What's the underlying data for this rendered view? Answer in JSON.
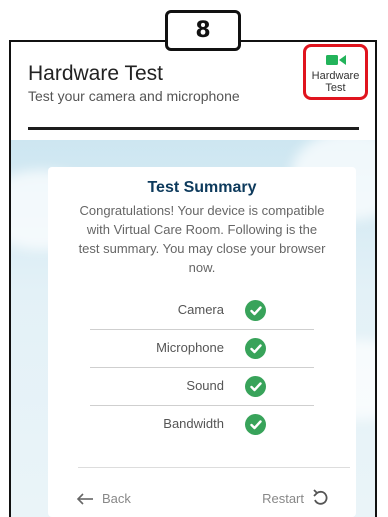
{
  "step_badge": "8",
  "header": {
    "title": "Hardware Test",
    "subtitle": "Test your camera and microphone",
    "hardware_test_button": {
      "line1": "Hardware",
      "line2": "Test",
      "icon": "video-camera-icon"
    }
  },
  "summary": {
    "title": "Test Summary",
    "body_lines": [
      "Congratulations! Your device is compatible",
      "with Virtual Care Room. Following is the",
      "test summary. You may close your browser",
      "now."
    ],
    "results": [
      {
        "label": "Camera",
        "status": "pass"
      },
      {
        "label": "Microphone",
        "status": "pass"
      },
      {
        "label": "Sound",
        "status": "pass"
      },
      {
        "label": "Bandwidth",
        "status": "pass"
      }
    ]
  },
  "footer": {
    "back_label": "Back",
    "restart_label": "Restart"
  },
  "colors": {
    "accent_red": "#e0141e",
    "brand_green": "#22b35a",
    "check_green": "#38a35a",
    "title_navy": "#0d3a5c"
  }
}
